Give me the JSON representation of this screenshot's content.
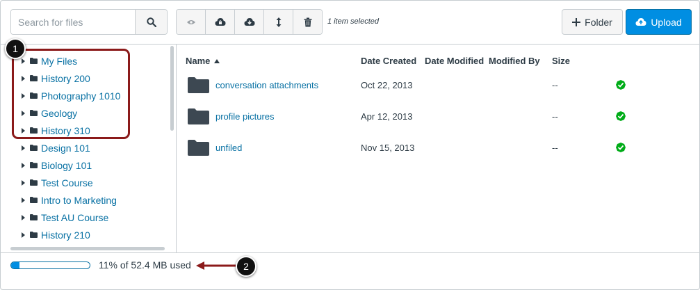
{
  "toolbar": {
    "search_placeholder": "Search for files",
    "selected_text": "1 item selected",
    "folder_label": "Folder",
    "upload_label": "Upload",
    "tools": [
      "eye-icon",
      "cloud-lock-icon",
      "cloud-download-icon",
      "move-vertical-icon",
      "trash-icon"
    ]
  },
  "tree": {
    "items": [
      {
        "label": "My Files"
      },
      {
        "label": "History 200"
      },
      {
        "label": "Photography 1010"
      },
      {
        "label": "Geology"
      },
      {
        "label": "History 310"
      },
      {
        "label": "Design 101"
      },
      {
        "label": "Biology 101"
      },
      {
        "label": "Test Course"
      },
      {
        "label": "Intro to Marketing"
      },
      {
        "label": "Test AU Course"
      },
      {
        "label": "History 210"
      }
    ]
  },
  "table": {
    "headers": {
      "name": "Name",
      "date_created": "Date Created",
      "date_modified": "Date Modified",
      "modified_by": "Modified By",
      "size": "Size"
    },
    "rows": [
      {
        "name": "conversation attachments",
        "date_created": "Oct 22, 2013",
        "size": "--"
      },
      {
        "name": "profile pictures",
        "date_created": "Apr 12, 2013",
        "size": "--"
      },
      {
        "name": "unfiled",
        "date_created": "Nov 15, 2013",
        "size": "--"
      }
    ]
  },
  "footer": {
    "usage_text": "11% of 52.4 MB used",
    "usage_percent": 11
  },
  "annotations": {
    "badge1": "1",
    "badge2": "2"
  },
  "colors": {
    "link": "#0770a3",
    "primary": "#008ee2",
    "success": "#00ac18",
    "annotation": "#8b1a1a"
  }
}
